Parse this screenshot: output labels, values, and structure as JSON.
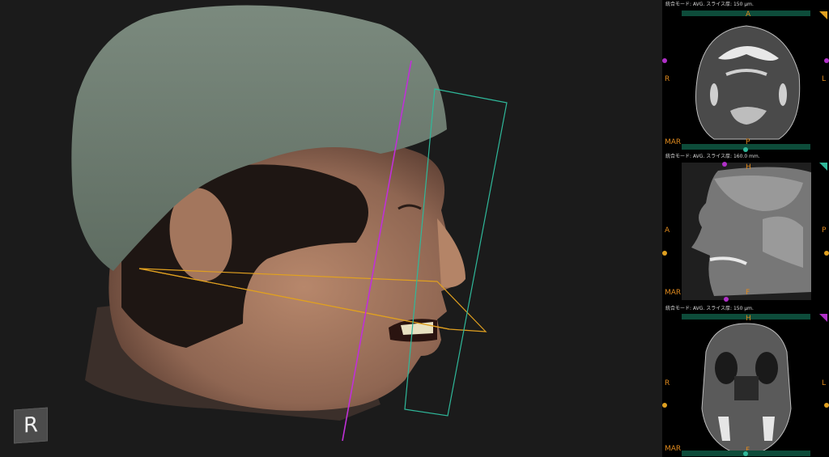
{
  "main_view": {
    "orientation_label": "R",
    "plane_colors": {
      "axial": "#e0a020",
      "sagittal": "#c030d8",
      "coronal": "#2fb89a"
    }
  },
  "panes": [
    {
      "id": "axial",
      "info": "統合モード: AVG. スライス厚: 150 μm.",
      "top_label": "A",
      "bottom_label": "P",
      "left_label": "R",
      "right_label": "L",
      "corner_label": "MAR",
      "accent_color": "#e0a020",
      "marker_color": "#b030c8"
    },
    {
      "id": "sagittal",
      "info": "統合モード: AVG. スライス厚: 160.0 mm.",
      "top_label": "H",
      "bottom_label": "F",
      "left_label": "A",
      "right_label": "P",
      "corner_label": "MAR",
      "accent_color": "#2fb89a",
      "marker_color": "#e0a020"
    },
    {
      "id": "coronal",
      "info": "統合モード: AVG. スライス厚: 150 μm.",
      "top_label": "H",
      "bottom_label": "F",
      "left_label": "R",
      "right_label": "L",
      "corner_label": "MAR",
      "accent_color": "#b030c8",
      "marker_color": "#e0a020"
    }
  ]
}
